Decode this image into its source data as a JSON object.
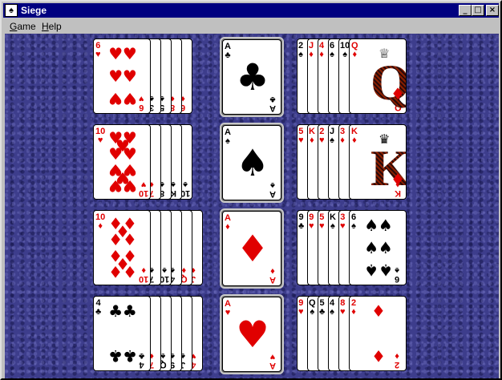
{
  "window": {
    "title": "Siege",
    "buttons": {
      "minimize": "_",
      "maximize": "□",
      "close": "×"
    }
  },
  "menu": [
    {
      "label": "Game",
      "hotkey": "G",
      "rest": "ame"
    },
    {
      "label": "Help",
      "hotkey": "H",
      "rest": "elp"
    }
  ],
  "colors": {
    "felt": "#3d3d8c",
    "red": "#e00000",
    "black": "#000000",
    "titlebar": "#000080"
  },
  "rows": [
    {
      "left": {
        "stack": [
          "3♠",
          "5♠",
          "8♦",
          "6♦"
        ],
        "top": {
          "rank": "6",
          "suit": "♥",
          "color": "red"
        }
      },
      "foundation": {
        "rank": "A",
        "suit": "♣",
        "color": "black"
      },
      "right": {
        "stack": [
          "2♠",
          "J♦",
          "4♦",
          "6♠",
          "10♠"
        ],
        "top": {
          "rank": "Q",
          "suit": "♦",
          "color": "red"
        }
      }
    },
    {
      "left": {
        "stack": [
          "7♦",
          "8♠",
          "K♠",
          "10♠"
        ],
        "top": {
          "rank": "10",
          "suit": "♥",
          "color": "red"
        }
      },
      "foundation": {
        "rank": "A",
        "suit": "♠",
        "color": "black"
      },
      "right": {
        "stack": [
          "5♥",
          "K♦",
          "2♥",
          "J♠",
          "3♦"
        ],
        "top": {
          "rank": "K",
          "suit": "♦",
          "color": "red"
        }
      }
    },
    {
      "left": {
        "stack": [
          "7♠",
          "10♠",
          "4♠",
          "Q♦",
          "J♦"
        ],
        "top": {
          "rank": "10",
          "suit": "♦",
          "color": "red"
        }
      },
      "foundation": {
        "rank": "A",
        "suit": "♦",
        "color": "red"
      },
      "right": {
        "stack": [
          "9♣",
          "9♥",
          "5♥",
          "K♠",
          "3♥"
        ],
        "top": {
          "rank": "6",
          "suit": "♠",
          "color": "black"
        }
      }
    },
    {
      "left": {
        "stack": [
          "7♦",
          "Q♠",
          "9♠",
          "J♠",
          "4♥"
        ],
        "top": {
          "rank": "4",
          "suit": "♣",
          "color": "black"
        }
      },
      "foundation": {
        "rank": "A",
        "suit": "♥",
        "color": "red"
      },
      "right": {
        "stack": [
          "9♥",
          "Q♠",
          "5♣",
          "4♠",
          "8♥"
        ],
        "top": {
          "rank": "2",
          "suit": "♦",
          "color": "red"
        }
      }
    }
  ]
}
